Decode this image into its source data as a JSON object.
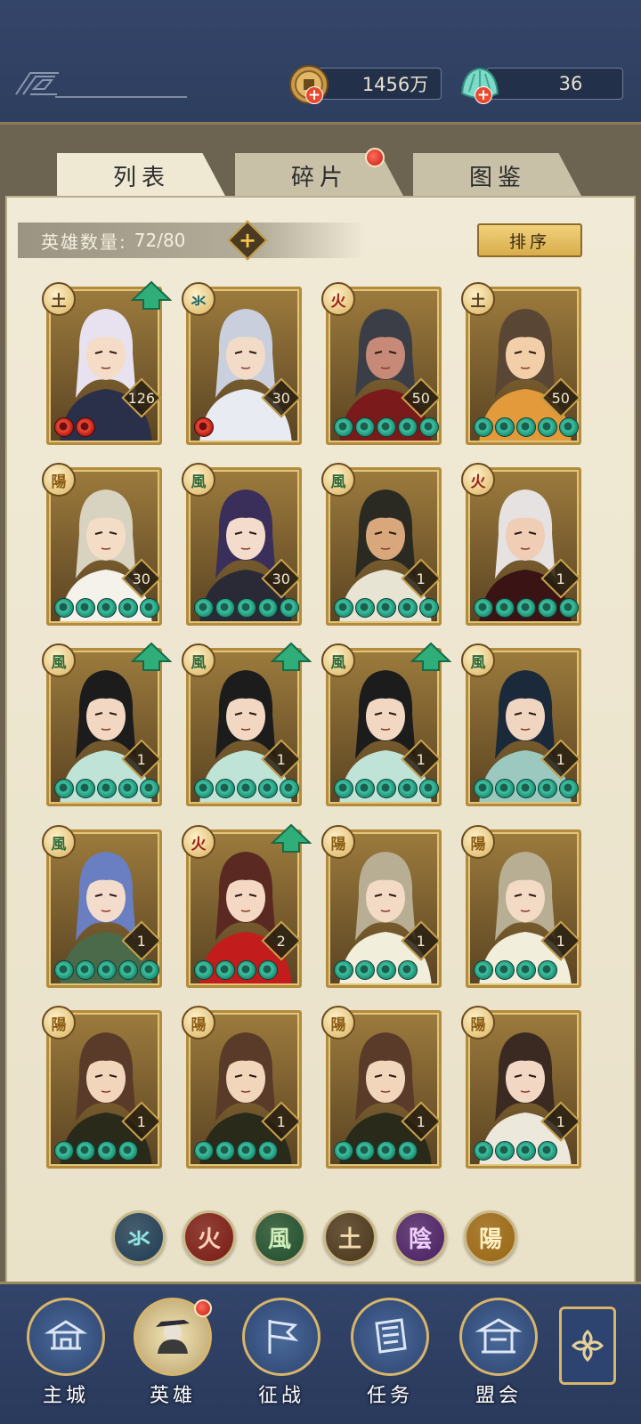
{
  "resources": {
    "coin": {
      "icon": "copper-coin-icon",
      "value": "1456万"
    },
    "jade": {
      "icon": "jade-shell-icon",
      "value": "36"
    }
  },
  "tabs": [
    {
      "label": "列表",
      "active": true
    },
    {
      "label": "碎片",
      "active": false,
      "red_dot": true
    },
    {
      "label": "图鉴",
      "active": false
    }
  ],
  "hero_count": {
    "label": "英雄数量:",
    "value": "72/80"
  },
  "sort_button": "排序",
  "element_symbols": {
    "water": "氺",
    "fire": "火",
    "wind": "風",
    "earth": "土",
    "yin": "陰",
    "yang": "陽"
  },
  "element_colors": {
    "water": "#1b6b6e",
    "fire": "#9a2217",
    "wind": "#2f6a3a",
    "earth": "#5a4122",
    "yin": "#6a2f8a",
    "yang": "#8a5a10"
  },
  "heroes": [
    {
      "element": "土",
      "element_key": "earth",
      "level": "126",
      "stars": 2,
      "star_color": "red",
      "upgrade": true,
      "hair": "#e8e2f0",
      "skin": "#f4dcc6",
      "cloth": "#2a2f4a"
    },
    {
      "element": "氺",
      "element_key": "water",
      "level": "30",
      "stars": 1,
      "star_color": "red",
      "upgrade": false,
      "hair": "#c9cfdc",
      "skin": "#f2dcc8",
      "cloth": "#e8ecf2"
    },
    {
      "element": "火",
      "element_key": "fire",
      "level": "50",
      "stars": 5,
      "star_color": "green",
      "upgrade": false,
      "hair": "#3b3e46",
      "skin": "#c78a78",
      "cloth": "#7a1a1a"
    },
    {
      "element": "土",
      "element_key": "earth",
      "level": "50",
      "stars": 5,
      "star_color": "green",
      "upgrade": false,
      "hair": "#5a4634",
      "skin": "#f2cfa8",
      "cloth": "#e39a3a"
    },
    {
      "element": "陽",
      "element_key": "yang",
      "level": "30",
      "stars": 5,
      "star_color": "green",
      "upgrade": false,
      "hair": "#d8d2c0",
      "skin": "#f4ddc6",
      "cloth": "#f4f2ea"
    },
    {
      "element": "風",
      "element_key": "wind",
      "level": "30",
      "stars": 5,
      "star_color": "green",
      "upgrade": false,
      "hair": "#3a2f5a",
      "skin": "#f4dccc",
      "cloth": "#2a2a36"
    },
    {
      "element": "風",
      "element_key": "wind",
      "level": "1",
      "stars": 5,
      "star_color": "green",
      "upgrade": false,
      "hair": "#2a2a22",
      "skin": "#d9a77c",
      "cloth": "#e8e4d4"
    },
    {
      "element": "火",
      "element_key": "fire",
      "level": "1",
      "stars": 5,
      "star_color": "green",
      "upgrade": false,
      "hair": "#e6e2e2",
      "skin": "#f0cdb5",
      "cloth": "#3a1414"
    },
    {
      "element": "風",
      "element_key": "wind",
      "level": "1",
      "stars": 5,
      "star_color": "green",
      "upgrade": true,
      "hair": "#1c1c1c",
      "skin": "#f2d8c2",
      "cloth": "#bfe3d6"
    },
    {
      "element": "風",
      "element_key": "wind",
      "level": "1",
      "stars": 5,
      "star_color": "green",
      "upgrade": true,
      "hair": "#1c1c1c",
      "skin": "#f2d8c2",
      "cloth": "#bfe3d6"
    },
    {
      "element": "風",
      "element_key": "wind",
      "level": "1",
      "stars": 5,
      "star_color": "green",
      "upgrade": true,
      "hair": "#1c1c1c",
      "skin": "#f2d8c2",
      "cloth": "#bfe3d6"
    },
    {
      "element": "風",
      "element_key": "wind",
      "level": "1",
      "stars": 5,
      "star_color": "green",
      "upgrade": false,
      "hair": "#1a2a3a",
      "skin": "#f0d6c0",
      "cloth": "#9bc9c0"
    },
    {
      "element": "風",
      "element_key": "wind",
      "level": "1",
      "stars": 5,
      "star_color": "green",
      "upgrade": false,
      "hair": "#6a7ec2",
      "skin": "#f4dccc",
      "cloth": "#4a6a4a"
    },
    {
      "element": "火",
      "element_key": "fire",
      "level": "2",
      "stars": 4,
      "star_color": "green",
      "upgrade": true,
      "hair": "#5a2a22",
      "skin": "#f4d8c4",
      "cloth": "#c21c1c"
    },
    {
      "element": "陽",
      "element_key": "yang",
      "level": "1",
      "stars": 4,
      "star_color": "green",
      "upgrade": false,
      "hair": "#b8ae94",
      "skin": "#f2dac4",
      "cloth": "#f2eedc"
    },
    {
      "element": "陽",
      "element_key": "yang",
      "level": "1",
      "stars": 4,
      "star_color": "green",
      "upgrade": false,
      "hair": "#b8ae94",
      "skin": "#f2dac4",
      "cloth": "#f2eedc"
    },
    {
      "element": "陽",
      "element_key": "yang",
      "level": "1",
      "stars": 4,
      "star_color": "green",
      "upgrade": false,
      "hair": "#5a3a28",
      "skin": "#f2d6bc",
      "cloth": "#2a2a1a"
    },
    {
      "element": "陽",
      "element_key": "yang",
      "level": "1",
      "stars": 4,
      "star_color": "green",
      "upgrade": false,
      "hair": "#5a3a28",
      "skin": "#f2d6bc",
      "cloth": "#2a2a1a"
    },
    {
      "element": "陽",
      "element_key": "yang",
      "level": "1",
      "stars": 4,
      "star_color": "green",
      "upgrade": false,
      "hair": "#5a3a28",
      "skin": "#f2d6bc",
      "cloth": "#2a2a1a"
    },
    {
      "element": "陽",
      "element_key": "yang",
      "level": "1",
      "stars": 4,
      "star_color": "green",
      "upgrade": false,
      "hair": "#3a2a22",
      "skin": "#f2d8c4",
      "cloth": "#ece8dc"
    }
  ],
  "element_filters": [
    {
      "symbol": "氺",
      "key": "water",
      "bg": "#1f3c55",
      "fg": "#8fe6e2"
    },
    {
      "symbol": "火",
      "key": "fire",
      "bg": "#7a1a14",
      "fg": "#ffd2b8"
    },
    {
      "symbol": "風",
      "key": "wind",
      "bg": "#1f4e2c",
      "fg": "#cfeebc"
    },
    {
      "symbol": "土",
      "key": "earth",
      "bg": "#4a351a",
      "fg": "#f2dcae"
    },
    {
      "symbol": "陰",
      "key": "yin",
      "bg": "#4a1f66",
      "fg": "#f0cfff"
    },
    {
      "symbol": "陽",
      "key": "yang",
      "bg": "#9a6612",
      "fg": "#fff2c2"
    }
  ],
  "bottom_nav": [
    {
      "label": "主城",
      "icon": "city-gate-icon",
      "active": false
    },
    {
      "label": "英雄",
      "icon": "hero-portrait-icon",
      "active": true,
      "red_dot": true
    },
    {
      "label": "征战",
      "icon": "campaign-banner-icon",
      "active": false
    },
    {
      "label": "任务",
      "icon": "task-scroll-icon",
      "active": false
    },
    {
      "label": "盟会",
      "icon": "alliance-pavilion-icon",
      "active": false
    }
  ],
  "menu_icon": "four-petal-menu-icon"
}
